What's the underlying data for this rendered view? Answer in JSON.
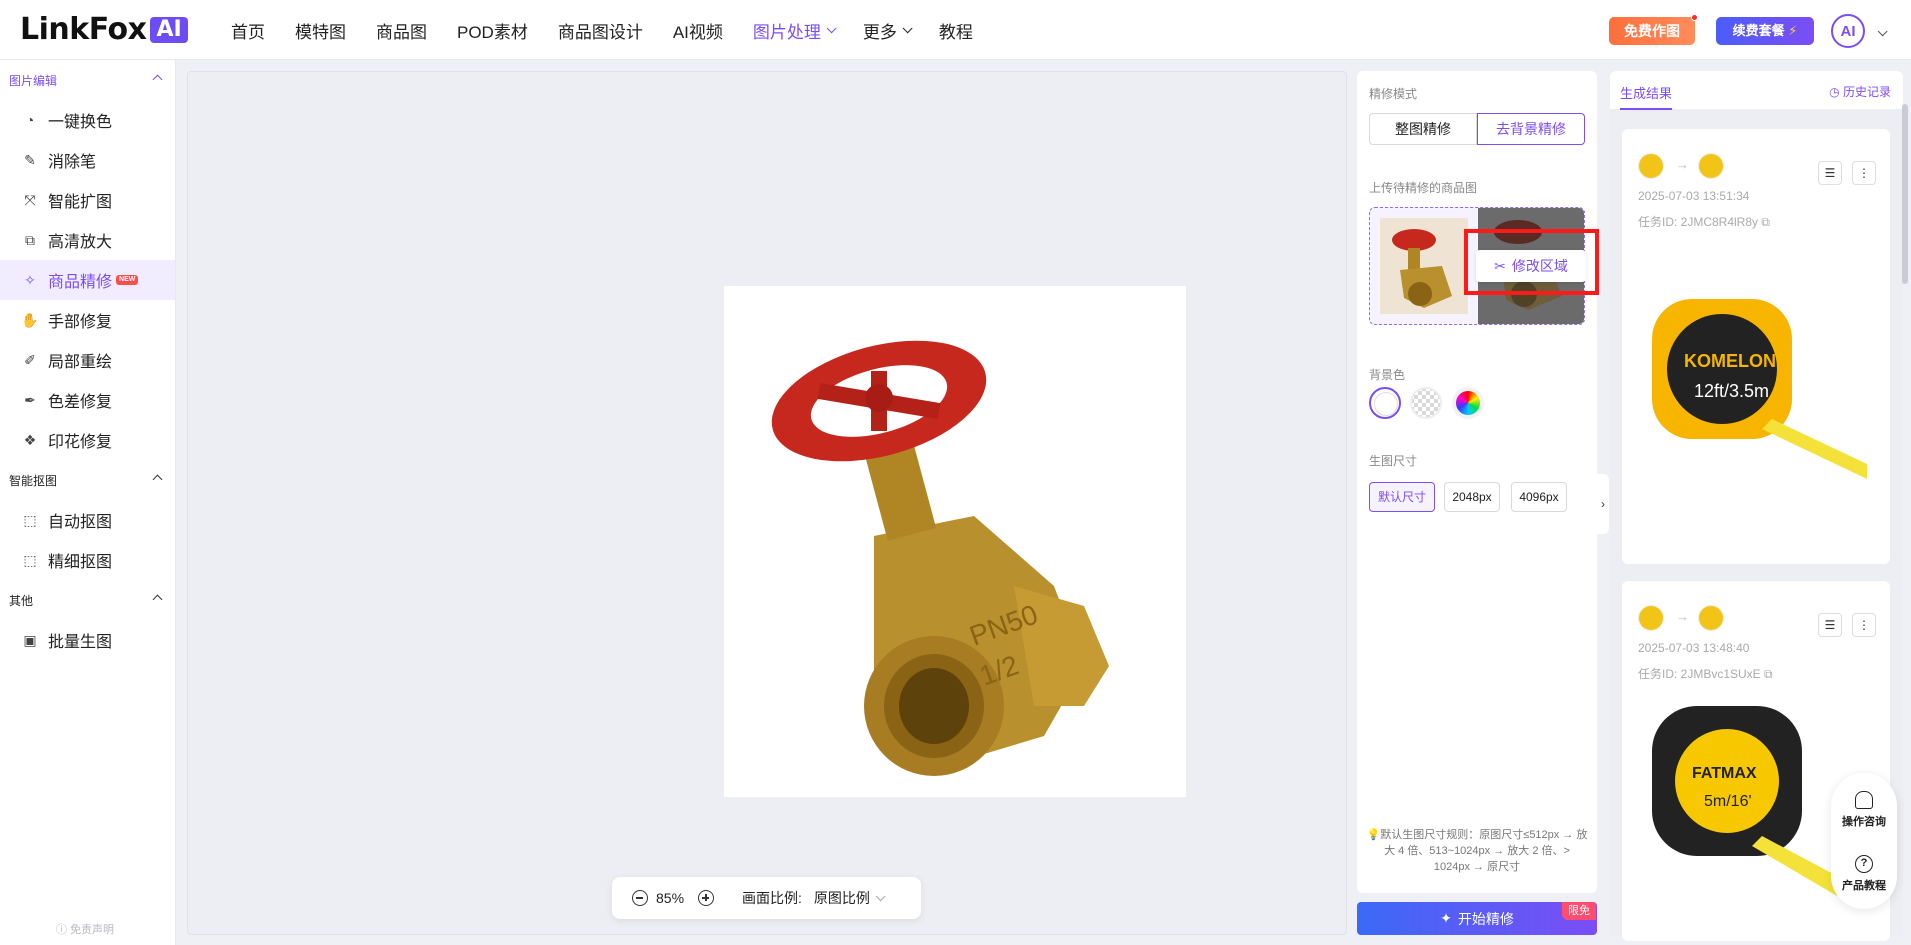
{
  "header": {
    "logo_text": "LinkFox",
    "logo_badge": "AI",
    "nav": [
      {
        "label": "首页"
      },
      {
        "label": "模特图"
      },
      {
        "label": "商品图"
      },
      {
        "label": "POD素材"
      },
      {
        "label": "商品图设计"
      },
      {
        "label": "AI视频"
      },
      {
        "label": "图片处理",
        "active": true,
        "dropdown": true
      },
      {
        "label": "更多",
        "dropdown": true
      },
      {
        "label": "教程"
      }
    ],
    "free_btn": "免费作图",
    "renew_btn": "续费套餐",
    "avatar": "AI"
  },
  "sidebar": {
    "sections": [
      {
        "title": "图片编辑",
        "items": [
          "一键换色",
          "消除笔",
          "智能扩图",
          "高清放大",
          "商品精修",
          "手部修复",
          "局部重绘",
          "色差修复",
          "印花修复"
        ]
      },
      {
        "title": "智能抠图",
        "items": [
          "自动抠图",
          "精细抠图"
        ]
      },
      {
        "title": "其他",
        "items": [
          "批量生图"
        ]
      }
    ],
    "active_item": "商品精修",
    "new_badge": "NEW",
    "disclaimer": "免责声明"
  },
  "canvas": {
    "zoom": "85%",
    "ratio_label": "画面比例:",
    "ratio_value": "原图比例"
  },
  "settings": {
    "mode_label": "精修模式",
    "mode_options": [
      "整图精修",
      "去背景精修"
    ],
    "mode_selected": "去背景精修",
    "upload_label": "上传待精修的商品图",
    "modify_btn": "修改区域",
    "bg_label": "背景色",
    "size_label": "生图尺寸",
    "sizes": [
      "默认尺寸",
      "2048px",
      "4096px"
    ],
    "size_selected": "默认尺寸",
    "tip": "默认生图尺寸规则：原图尺寸≤512px → 放大 4 倍、513~1024px → 放大 2 倍、> 1024px → 原尺寸",
    "start_btn": "开始精修",
    "limit_badge": "限免"
  },
  "results": {
    "tab": "生成结果",
    "history": "历史记录",
    "cards": [
      {
        "date": "2025-07-03 13:51:34",
        "task_id": "任务ID: 2JMC8R4lR8y"
      },
      {
        "date": "2025-07-03 13:48:40",
        "task_id": "任务ID: 2JMBvc1SUxE"
      }
    ]
  },
  "float": {
    "consult": "操作咨询",
    "tutorial": "产品教程"
  },
  "colors": {
    "accent": "#7b4df5",
    "orange": "#ff7a45",
    "red_highlight": "#ff1a1a"
  }
}
